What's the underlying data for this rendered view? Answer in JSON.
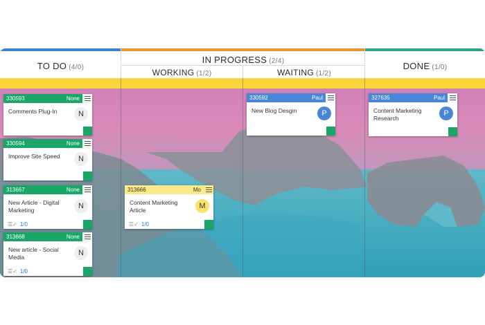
{
  "columns": {
    "todo": {
      "title": "TO DO",
      "count": "(4/0)"
    },
    "inprogress": {
      "title": "IN PROGRESS",
      "count": "(2/4)"
    },
    "working": {
      "title": "WORKING",
      "count": "(1/2)"
    },
    "waiting": {
      "title": "WAITING",
      "count": "(1/2)"
    },
    "done": {
      "title": "DONE",
      "count": "(1/0)"
    }
  },
  "colors": {
    "green": "#1aa667",
    "blue": "#4a86d8",
    "yellow_card": "#fbe98a",
    "yellow_band": "#fbd63a",
    "orange_top": "#e8962a",
    "teal_top": "#2aa08a",
    "blue_top": "#3a7fd0"
  },
  "cards": {
    "c1": {
      "id": "330593",
      "owner": "None",
      "title": "Comments Plug-In",
      "avatar": "N"
    },
    "c2": {
      "id": "330594",
      "owner": "None",
      "title": "Improve Site Speed",
      "avatar": "N"
    },
    "c3": {
      "id": "313667",
      "owner": "None",
      "title": "New Article - Digital Marketing",
      "avatar": "N",
      "progress": "1/0"
    },
    "c4": {
      "id": "313668",
      "owner": "None",
      "title": "New article - Social Media",
      "avatar": "N",
      "progress": "1/0"
    },
    "c5": {
      "id": "313666",
      "owner": "Mo",
      "title": "Content Marketing Article",
      "avatar": "M",
      "progress": "1/0"
    },
    "c6": {
      "id": "330592",
      "owner": "Paul",
      "title": "New Blog Desgin",
      "avatar": "P"
    },
    "c7": {
      "id": "327635",
      "owner": "Paul",
      "title": "Content Marketing Research",
      "avatar": "P"
    }
  }
}
